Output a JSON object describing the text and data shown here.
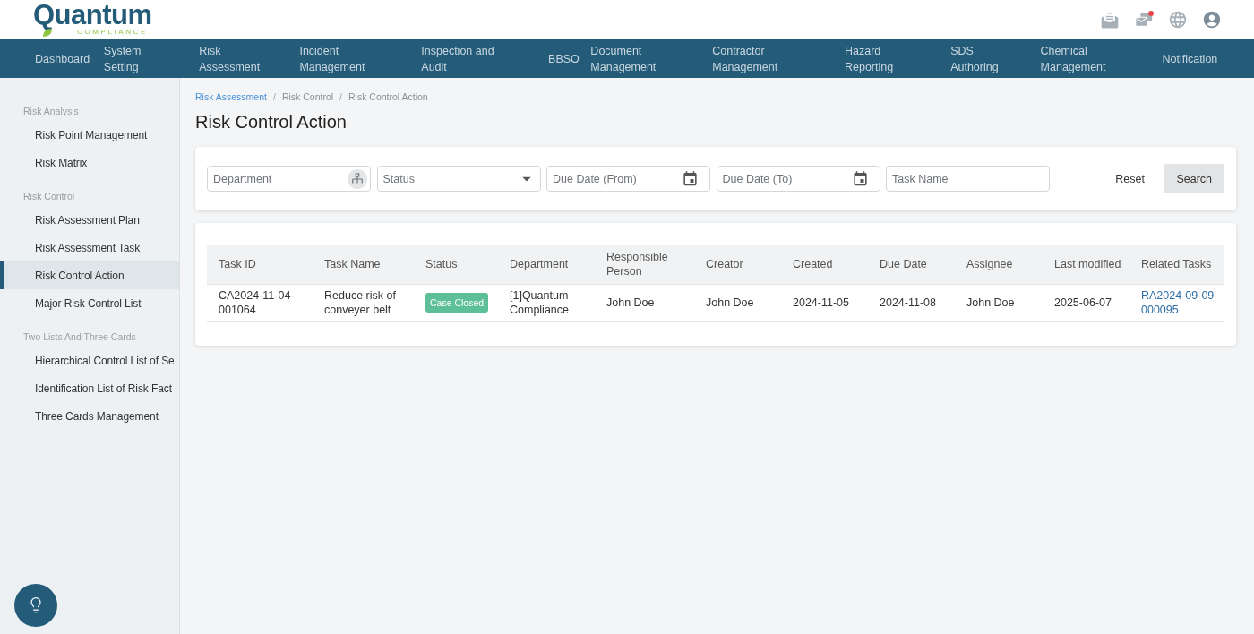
{
  "header": {
    "logo": {
      "name": "Quantum",
      "tagline": "COMPLIANCE"
    },
    "unread_messages": true
  },
  "nav": [
    {
      "label": "Dashboard"
    },
    {
      "label": "System\nSetting"
    },
    {
      "label": "Risk\nAssessment"
    },
    {
      "label": "Incident\nManagement"
    },
    {
      "label": "Inspection and\nAudit"
    },
    {
      "label": "BBSO"
    },
    {
      "label": "Document\nManagement"
    },
    {
      "label": "Contractor\nManagement"
    },
    {
      "label": "Hazard\nReporting"
    },
    {
      "label": "SDS\nAuthoring"
    },
    {
      "label": "Chemical\nManagement"
    },
    {
      "label": "Notification"
    }
  ],
  "sidebar": {
    "sections": [
      {
        "title": "Risk Analysis",
        "items": [
          {
            "label": "Risk Point Management",
            "selected": false
          },
          {
            "label": "Risk Matrix",
            "selected": false
          }
        ]
      },
      {
        "title": "Risk Control",
        "items": [
          {
            "label": "Risk Assessment Plan",
            "selected": false
          },
          {
            "label": "Risk Assessment Task",
            "selected": false
          },
          {
            "label": "Risk Control Action",
            "selected": true
          },
          {
            "label": "Major Risk Control List",
            "selected": false
          }
        ]
      },
      {
        "title": "Two Lists And Three Cards",
        "items": [
          {
            "label": "Hierarchical Control List of Se",
            "selected": false
          },
          {
            "label": "Identification List of Risk Fact",
            "selected": false
          },
          {
            "label": "Three Cards Management",
            "selected": false
          }
        ]
      }
    ]
  },
  "breadcrumb": {
    "separator": "/",
    "items": [
      {
        "label": "Risk Assessment",
        "kind": "link"
      },
      {
        "label": "Risk Control",
        "kind": "text"
      },
      {
        "label": "Risk Control Action",
        "kind": "text"
      }
    ]
  },
  "page_title": "Risk Control Action",
  "filters": {
    "fields": [
      {
        "placeholder": "Department",
        "kind": "tree"
      },
      {
        "placeholder": "Status",
        "kind": "select"
      },
      {
        "placeholder": "Due Date (From)",
        "kind": "date"
      },
      {
        "placeholder": "Due Date (To)",
        "kind": "date"
      },
      {
        "placeholder": "Task Name",
        "kind": "text"
      }
    ],
    "buttons": [
      {
        "label": "Reset",
        "kind": "plain"
      },
      {
        "label": "Search",
        "kind": "filled"
      }
    ]
  },
  "table": {
    "columns": [
      "Task ID",
      "Task Name",
      "Status",
      "Department",
      "Responsible Person",
      "Creator",
      "Created",
      "Due Date",
      "Assignee",
      "Last modified",
      "Related Tasks"
    ],
    "rows": [
      {
        "cells": [
          {
            "kind": "text",
            "text": "CA2024-11-04-001064"
          },
          {
            "kind": "text",
            "text": "Reduce risk of conveyer belt"
          },
          {
            "kind": "badge",
            "text": "Case Closed",
            "color": "#5cbf98"
          },
          {
            "kind": "text",
            "text": "[1]Quantum Compliance"
          },
          {
            "kind": "text",
            "text": "John Doe"
          },
          {
            "kind": "text",
            "text": "John Doe"
          },
          {
            "kind": "text",
            "text": "2024-11-05"
          },
          {
            "kind": "text",
            "text": "2024-11-08"
          },
          {
            "kind": "text",
            "text": "John Doe"
          },
          {
            "kind": "text",
            "text": "2025-06-07"
          },
          {
            "kind": "link",
            "text": "RA2024-09-09-000095"
          }
        ]
      }
    ]
  }
}
